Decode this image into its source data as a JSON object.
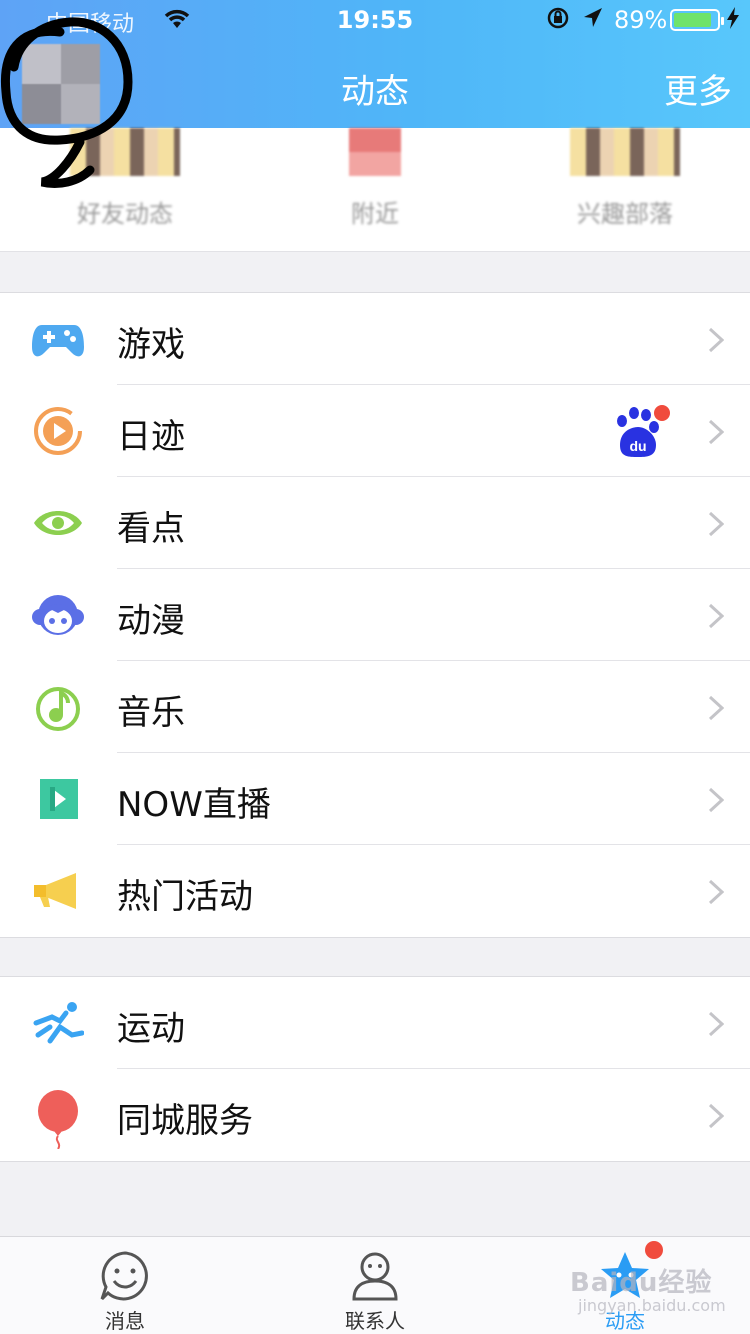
{
  "status_bar": {
    "carrier": "中国移动",
    "time": "19:55",
    "battery_percent": "89%",
    "battery_level": 0.89
  },
  "nav": {
    "title": "动态",
    "more": "更多"
  },
  "shortcuts": [
    {
      "label": "好友动态"
    },
    {
      "label": "附近"
    },
    {
      "label": "兴趣部落"
    }
  ],
  "group1": [
    {
      "label": "游戏",
      "icon": "gamepad-icon",
      "color": "#4fa9f0"
    },
    {
      "label": "日迹",
      "icon": "play-circle-icon",
      "color": "#f4a056"
    },
    {
      "label": "看点",
      "icon": "eye-icon",
      "color": "#8ccf4f"
    },
    {
      "label": "动漫",
      "icon": "anime-face-icon",
      "color": "#5b6fe6"
    },
    {
      "label": "音乐",
      "icon": "music-note-icon",
      "color": "#8ccf4f"
    },
    {
      "label": "NOW直播",
      "icon": "now-live-icon",
      "color": "#3dc8a0"
    },
    {
      "label": "热门活动",
      "icon": "megaphone-icon",
      "color": "#f6cf4f"
    }
  ],
  "group2": [
    {
      "label": "运动",
      "icon": "running-icon",
      "color": "#3aa4f2"
    },
    {
      "label": "同城服务",
      "icon": "balloon-icon",
      "color": "#ee5f5a"
    }
  ],
  "tabbar": [
    {
      "label": "消息",
      "icon": "smiley-chat-icon",
      "active": false
    },
    {
      "label": "联系人",
      "icon": "person-icon",
      "active": false
    },
    {
      "label": "动态",
      "icon": "star-icon",
      "active": true
    }
  ],
  "watermark": {
    "text": "Baidu经验",
    "sub": "jingyan.baidu.com"
  }
}
